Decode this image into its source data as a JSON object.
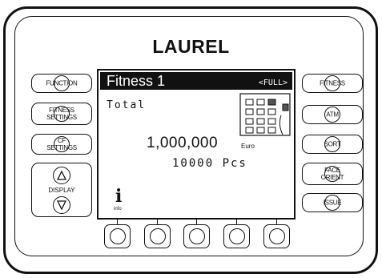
{
  "brand": {
    "name": "LAUREL"
  },
  "left_buttons": [
    {
      "lines": [
        "FUNCTION"
      ]
    },
    {
      "lines": [
        "FITNESS",
        "SETTINGS"
      ]
    },
    {
      "lines": [
        "CF",
        "SETTINGS"
      ]
    }
  ],
  "display_button": {
    "label": "DISPLAY"
  },
  "right_buttons": [
    {
      "lines": [
        "FITNESS"
      ]
    },
    {
      "lines": [
        "ATM"
      ]
    },
    {
      "lines": [
        "SORT"
      ]
    },
    {
      "lines": [
        "FACE",
        "ORIENT"
      ]
    },
    {
      "lines": [
        "ISSUE"
      ]
    }
  ],
  "screen": {
    "title": "Fitness 1",
    "mode": "<FULL>",
    "total_label": "Total",
    "amount": "1,000,000",
    "currency": "Euro",
    "count": "10000 Pcs",
    "info_icon": "i",
    "info_label": "info"
  },
  "soft_keys_count": 5,
  "icons": [
    "up-triangle-icon",
    "down-triangle-icon",
    "info-icon",
    "pocket-grid-icon"
  ]
}
